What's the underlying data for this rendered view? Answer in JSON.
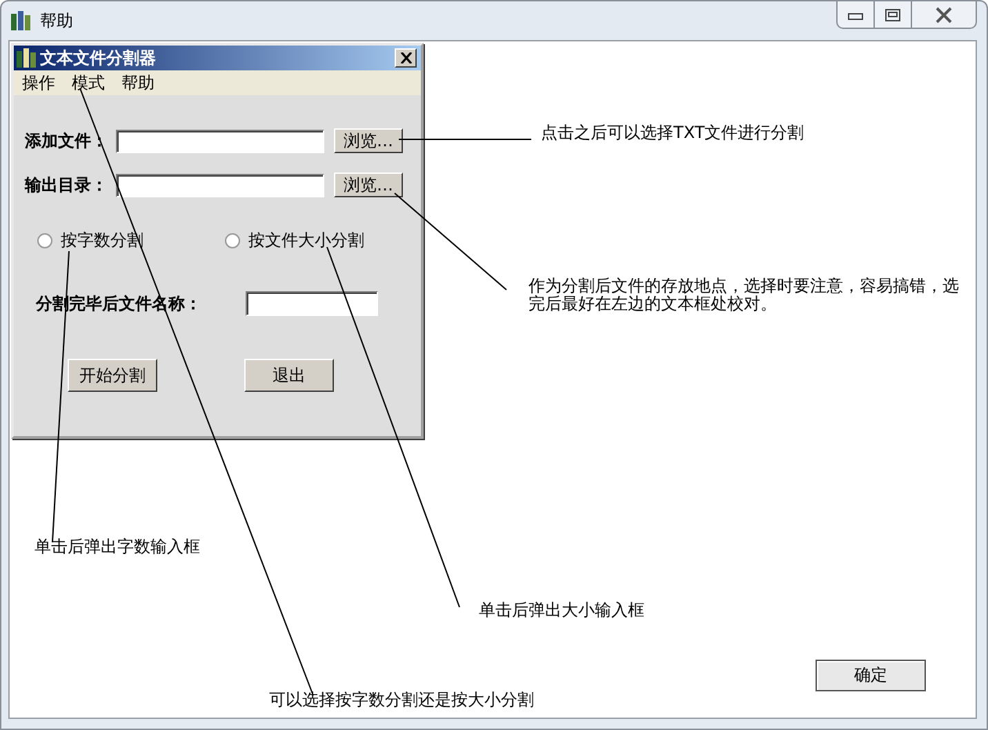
{
  "window": {
    "title": "帮助"
  },
  "dialog": {
    "title": "文本文件分割器",
    "menu": [
      "操作",
      "模式",
      "帮助"
    ],
    "file_rows": [
      {
        "label": "添加文件：",
        "button": "浏览…"
      },
      {
        "label": "输出目录：",
        "button": "浏览…"
      }
    ],
    "radios": [
      {
        "label": "按字数分割",
        "selected": false
      },
      {
        "label": "按文件大小分割",
        "selected": false
      }
    ],
    "name_label": "分割完毕后文件名称：",
    "buttons": [
      "开始分割",
      "退出"
    ]
  },
  "annotations": [
    "点击之后可以选择TXT文件进行分割",
    "作为分割后文件的存放地点，选择时要注意，容易搞错，选完后最好在左边的文本框处校对。",
    "单击后弹出字数输入框",
    "可以选择按字数分割还是按大小分割",
    "单击后弹出大小输入框"
  ],
  "ok_button": "确定"
}
